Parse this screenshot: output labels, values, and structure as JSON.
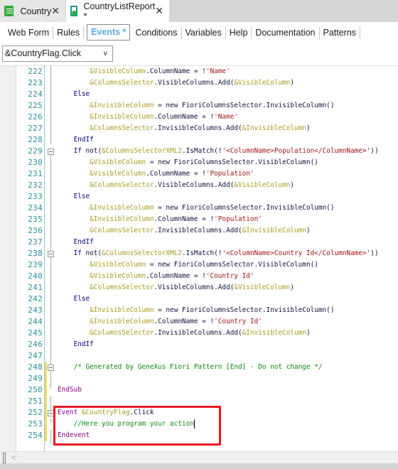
{
  "tabs": [
    {
      "label": "Country",
      "icon": "grid-icon"
    },
    {
      "label": "CountryListReport *",
      "icon": "report-icon"
    }
  ],
  "subtabs": [
    "Web Form",
    "Rules",
    "Events *",
    "Conditions",
    "Variables",
    "Help",
    "Documentation",
    "Patterns"
  ],
  "selected_subtab": "Events *",
  "event_selector": {
    "value": "&CountryFlag.Click"
  },
  "colors": {
    "accent": "#5aaae8",
    "highlight_box": "#e81c24",
    "keyword": "#000080",
    "event_keyword": "#880088",
    "variable": "#a89a1e",
    "string": "#a31515",
    "comment": "#0a8a0a"
  },
  "code": {
    "lines": [
      {
        "n": "222",
        "s": [
          [
            "pl",
            "        "
          ],
          [
            "var",
            "&VisibleColumn"
          ],
          [
            "pl",
            ".ColumnName = !"
          ],
          [
            "str",
            "'Name'"
          ]
        ]
      },
      {
        "n": "223",
        "s": [
          [
            "pl",
            "        "
          ],
          [
            "var",
            "&ColumnsSelector"
          ],
          [
            "pl",
            ".VisibleColumns.Add("
          ],
          [
            "var",
            "&VisibleColumn"
          ],
          [
            "pl",
            ")"
          ]
        ]
      },
      {
        "n": "224",
        "s": [
          [
            "pl",
            "    "
          ],
          [
            "kw",
            "Else"
          ]
        ]
      },
      {
        "n": "225",
        "s": [
          [
            "pl",
            "        "
          ],
          [
            "var",
            "&InvisibleColumn"
          ],
          [
            "pl",
            " = new FioriColumnsSelector.InvisibleColumn()"
          ]
        ]
      },
      {
        "n": "226",
        "s": [
          [
            "pl",
            "        "
          ],
          [
            "var",
            "&InvisibleColumn"
          ],
          [
            "pl",
            ".ColumnName = !"
          ],
          [
            "str",
            "'Name'"
          ]
        ]
      },
      {
        "n": "227",
        "s": [
          [
            "pl",
            "        "
          ],
          [
            "var",
            "&ColumnsSelector"
          ],
          [
            "pl",
            ".InvisibleColumns.Add("
          ],
          [
            "var",
            "&InvisibleColumn"
          ],
          [
            "pl",
            ")"
          ]
        ]
      },
      {
        "n": "228",
        "s": [
          [
            "pl",
            "    "
          ],
          [
            "kw",
            "EndIf"
          ]
        ]
      },
      {
        "n": "229",
        "s": [
          [
            "pl",
            "    "
          ],
          [
            "kw",
            "If"
          ],
          [
            "pl",
            " not("
          ],
          [
            "var",
            "&ColumnsSelectorXML2"
          ],
          [
            "pl",
            ".IsMatch(!"
          ],
          [
            "str",
            "'<ColumnName>Population</ColumnName>'"
          ],
          [
            "pl",
            "))"
          ]
        ]
      },
      {
        "n": "230",
        "s": [
          [
            "pl",
            "        "
          ],
          [
            "var",
            "&VisibleColumn"
          ],
          [
            "pl",
            " = new FioriColumnsSelector.VisibleColumn()"
          ]
        ]
      },
      {
        "n": "231",
        "s": [
          [
            "pl",
            "        "
          ],
          [
            "var",
            "&VisibleColumn"
          ],
          [
            "pl",
            ".ColumnName = !"
          ],
          [
            "str",
            "'Population'"
          ]
        ]
      },
      {
        "n": "232",
        "s": [
          [
            "pl",
            "        "
          ],
          [
            "var",
            "&ColumnsSelector"
          ],
          [
            "pl",
            ".VisibleColumns.Add("
          ],
          [
            "var",
            "&VisibleColumn"
          ],
          [
            "pl",
            ")"
          ]
        ]
      },
      {
        "n": "233",
        "s": [
          [
            "pl",
            "    "
          ],
          [
            "kw",
            "Else"
          ]
        ]
      },
      {
        "n": "234",
        "s": [
          [
            "pl",
            "        "
          ],
          [
            "var",
            "&InvisibleColumn"
          ],
          [
            "pl",
            " = new FioriColumnsSelector.InvisibleColumn()"
          ]
        ]
      },
      {
        "n": "235",
        "s": [
          [
            "pl",
            "        "
          ],
          [
            "var",
            "&InvisibleColumn"
          ],
          [
            "pl",
            ".ColumnName = !"
          ],
          [
            "str",
            "'Population'"
          ]
        ]
      },
      {
        "n": "236",
        "s": [
          [
            "pl",
            "        "
          ],
          [
            "var",
            "&ColumnsSelector"
          ],
          [
            "pl",
            ".InvisibleColumns.Add("
          ],
          [
            "var",
            "&InvisibleColumn"
          ],
          [
            "pl",
            ")"
          ]
        ]
      },
      {
        "n": "237",
        "s": [
          [
            "pl",
            "    "
          ],
          [
            "kw",
            "EndIf"
          ]
        ]
      },
      {
        "n": "238",
        "s": [
          [
            "pl",
            "    "
          ],
          [
            "kw",
            "If"
          ],
          [
            "pl",
            " not("
          ],
          [
            "var",
            "&ColumnsSelectorXML2"
          ],
          [
            "pl",
            ".IsMatch(!"
          ],
          [
            "str",
            "'<ColumnName>Country Id</ColumnName>'"
          ],
          [
            "pl",
            "))"
          ]
        ]
      },
      {
        "n": "239",
        "s": [
          [
            "pl",
            "        "
          ],
          [
            "var",
            "&VisibleColumn"
          ],
          [
            "pl",
            " = new FioriColumnsSelector.VisibleColumn()"
          ]
        ]
      },
      {
        "n": "240",
        "s": [
          [
            "pl",
            "        "
          ],
          [
            "var",
            "&VisibleColumn"
          ],
          [
            "pl",
            ".ColumnName = !"
          ],
          [
            "str",
            "'Country Id'"
          ]
        ]
      },
      {
        "n": "241",
        "s": [
          [
            "pl",
            "        "
          ],
          [
            "var",
            "&ColumnsSelector"
          ],
          [
            "pl",
            ".VisibleColumns.Add("
          ],
          [
            "var",
            "&VisibleColumn"
          ],
          [
            "pl",
            ")"
          ]
        ]
      },
      {
        "n": "242",
        "s": [
          [
            "pl",
            "    "
          ],
          [
            "kw",
            "Else"
          ]
        ]
      },
      {
        "n": "243",
        "s": [
          [
            "pl",
            "        "
          ],
          [
            "var",
            "&InvisibleColumn"
          ],
          [
            "pl",
            " = new FioriColumnsSelector.InvisibleColumn()"
          ]
        ]
      },
      {
        "n": "244",
        "s": [
          [
            "pl",
            "        "
          ],
          [
            "var",
            "&InvisibleColumn"
          ],
          [
            "pl",
            ".ColumnName = !"
          ],
          [
            "str",
            "'Country Id'"
          ]
        ]
      },
      {
        "n": "245",
        "s": [
          [
            "pl",
            "        "
          ],
          [
            "var",
            "&ColumnsSelector"
          ],
          [
            "pl",
            ".InvisibleColumns.Add("
          ],
          [
            "var",
            "&InvisibleColumn"
          ],
          [
            "pl",
            ")"
          ]
        ]
      },
      {
        "n": "246",
        "s": [
          [
            "pl",
            "    "
          ],
          [
            "kw",
            "EndIf"
          ]
        ]
      },
      {
        "n": "247",
        "s": []
      },
      {
        "n": "248",
        "s": [
          [
            "pl",
            "    "
          ],
          [
            "cm",
            "/* Generated by GeneXus Fiori Pattern [End] - Do not change */"
          ]
        ]
      },
      {
        "n": "249",
        "s": []
      },
      {
        "n": "250",
        "s": [
          [
            "kw2",
            "EndSub"
          ]
        ]
      },
      {
        "n": "251",
        "s": []
      },
      {
        "n": "252",
        "s": [
          [
            "kw2",
            "Event"
          ],
          [
            "pl",
            " "
          ],
          [
            "var",
            "&CountryFlag"
          ],
          [
            "pl",
            ".Click"
          ]
        ]
      },
      {
        "n": "253",
        "s": [
          [
            "pl",
            "    "
          ],
          [
            "cm",
            "//Here you program your action"
          ]
        ]
      },
      {
        "n": "254",
        "s": [
          [
            "kw2",
            "Endevent"
          ]
        ]
      }
    ]
  }
}
